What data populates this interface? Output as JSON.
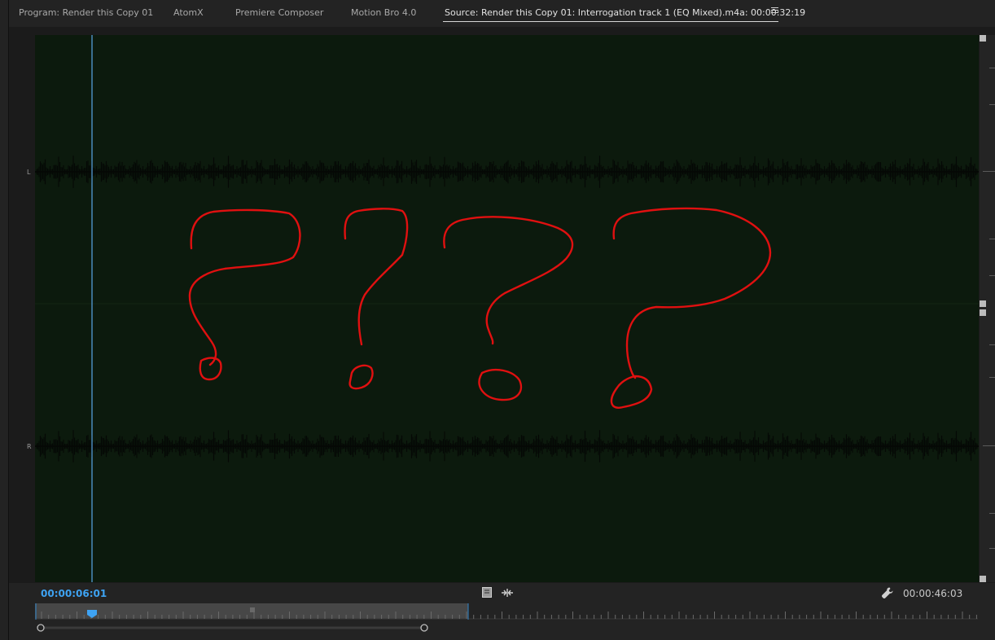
{
  "tabs": [
    {
      "label": "Program: Render this Copy 01"
    },
    {
      "label": "AtomX"
    },
    {
      "label": "Premiere Composer"
    },
    {
      "label": "Motion Bro 4.0"
    },
    {
      "label": "Source: Render this Copy 01: Interrogation track 1 (EQ Mixed).m4a: 00:00:32:19"
    }
  ],
  "channels": {
    "left": "L",
    "right": "R"
  },
  "timecodes": {
    "current": "00:00:06:01",
    "duration": "00:00:46:03"
  },
  "colors": {
    "waveform_bg": "#0c1a0d",
    "waveform": "#050805",
    "playhead": "#5aa7e6",
    "annotation": "#e01010",
    "timecode_blue": "#3ea3f3"
  },
  "icons": {
    "panel_menu": "hamburger-menu-icon",
    "marker": "marker-icon",
    "ripple": "ripple-icon",
    "settings": "wrench-icon"
  },
  "annotation": {
    "type": "hand-drawn",
    "symbols": "????"
  }
}
